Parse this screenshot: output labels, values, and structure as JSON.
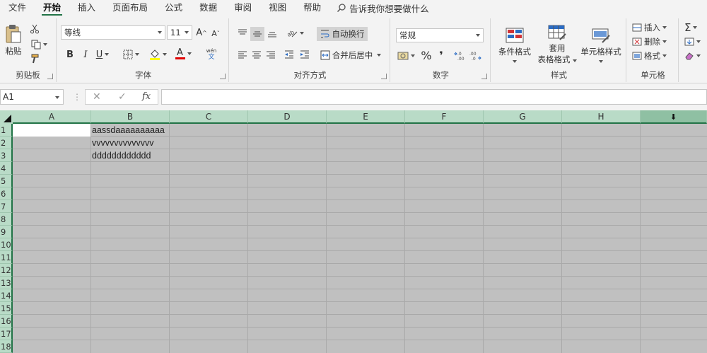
{
  "menu": {
    "tabs": [
      {
        "label": "文件"
      },
      {
        "label": "开始",
        "active": true
      },
      {
        "label": "插入"
      },
      {
        "label": "页面布局"
      },
      {
        "label": "公式"
      },
      {
        "label": "数据"
      },
      {
        "label": "审阅"
      },
      {
        "label": "视图"
      },
      {
        "label": "帮助"
      }
    ],
    "tell_me": "告诉我你想要做什么"
  },
  "ribbon": {
    "clipboard": {
      "label": "剪贴板",
      "paste": "粘贴"
    },
    "font": {
      "label": "字体",
      "font_name": "等线",
      "font_size": "11",
      "bold": "B",
      "italic": "I",
      "underline": "U",
      "grow": "A",
      "shrink": "A",
      "font_color_letter": "A",
      "phonetic": "wén",
      "phonetic_sub": "文"
    },
    "alignment": {
      "label": "对齐方式",
      "wrap_text": "自动换行",
      "merge_center": "合并后居中"
    },
    "number": {
      "label": "数字",
      "format": "常规",
      "percent": "%",
      "comma": "❜"
    },
    "styles": {
      "label": "样式",
      "conditional": "条件格式",
      "table_format_1": "套用",
      "table_format_2": "表格格式",
      "cell_styles": "单元格样式"
    },
    "cells": {
      "label": "单元格",
      "insert": "插入",
      "delete": "删除",
      "format": "格式"
    }
  },
  "formula_bar": {
    "name_box": "A1",
    "cancel": "✕",
    "enter": "✓",
    "fx": "fx",
    "value": ""
  },
  "sheet": {
    "columns": [
      "A",
      "B",
      "C",
      "D",
      "E",
      "F",
      "G",
      "H"
    ],
    "rows": [
      "1",
      "2",
      "3",
      "4",
      "5",
      "6",
      "7",
      "8",
      "9",
      "10",
      "11",
      "12",
      "13",
      "14",
      "15",
      "16",
      "17",
      "18"
    ],
    "cells": {
      "B1": "aassdaaaaaaaaaa",
      "B2": "vvvvvvvvvvvvvv",
      "B3": "dddddddddddd"
    },
    "selected_cell": "A1"
  },
  "colors": {
    "accent": "#217346",
    "header_bg": "#b9dbc7",
    "selection_gray": "#c0c0c0"
  }
}
